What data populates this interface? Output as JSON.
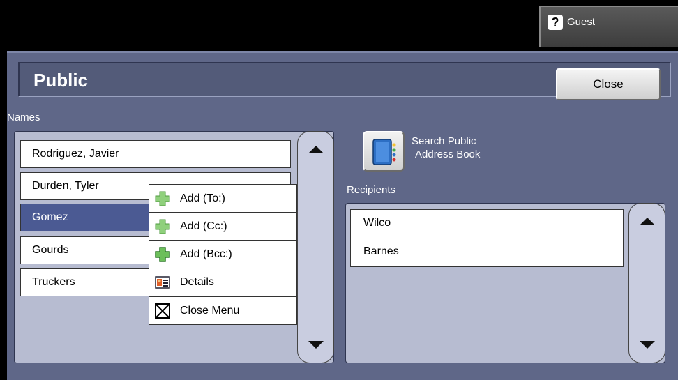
{
  "header": {
    "user_label": "Guest",
    "help_icon_glyph": "?"
  },
  "window": {
    "title": "Public",
    "close_label": "Close"
  },
  "names": {
    "label": "Names",
    "items": [
      "Rodriguez, Javier",
      "Durden, Tyler",
      "Gomez",
      "Gourds",
      "Truckers"
    ],
    "selected": "Gomez"
  },
  "context_menu": {
    "items": [
      {
        "label": "Add (To:)",
        "icon": "add-plus-icon"
      },
      {
        "label": "Add (Cc:)",
        "icon": "add-plus-icon"
      },
      {
        "label": "Add (Bcc:)",
        "icon": "add-plus-icon"
      },
      {
        "label": "Details",
        "icon": "details-card-icon"
      },
      {
        "label": "Close Menu",
        "icon": "close-box-icon"
      }
    ]
  },
  "search": {
    "line1": "Search Public",
    "line2": "Address Book"
  },
  "recipients": {
    "label": "Recipients",
    "items": [
      "Wilco",
      "Barnes"
    ]
  },
  "colors": {
    "panel": "#5f6788",
    "list_bg": "#b7bcd1",
    "selected": "#4b5a93",
    "plus_green": "#7fc46a"
  }
}
